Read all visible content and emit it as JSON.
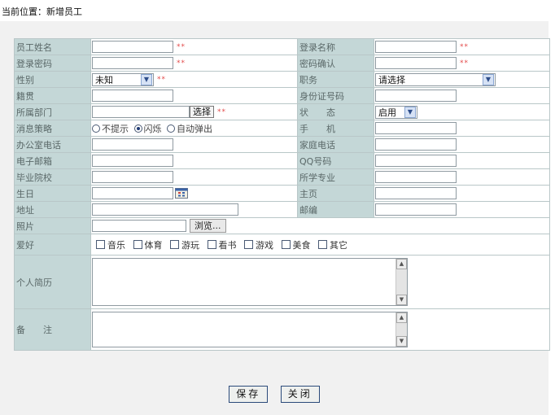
{
  "breadcrumb": "当前位置：新增员工",
  "required_mark": "**",
  "labels": {
    "name": "员工姓名",
    "login_name": "登录名称",
    "password": "登录密码",
    "password_confirm": "密码确认",
    "gender": "性别",
    "position": "职务",
    "native_place": "籍贯",
    "id_number": "身份证号码",
    "department": "所属部门",
    "status": "状　　态",
    "message_policy": "消息策略",
    "mobile": "手　　机",
    "office_phone": "办公室电话",
    "home_phone": "家庭电话",
    "email": "电子邮箱",
    "qq": "QQ号码",
    "school": "毕业院校",
    "major": "所学专业",
    "birthday": "生日",
    "homepage": "主页",
    "address": "地址",
    "postcode": "邮编",
    "photo": "照片",
    "hobbies": "爱好",
    "resume": "个人简历",
    "remark": "备　　注"
  },
  "selects": {
    "gender": "未知",
    "position": "请选择",
    "status": "启用"
  },
  "buttons": {
    "choose": "选择",
    "browse": "浏览...",
    "save": "保存",
    "close": "关闭"
  },
  "message_options": [
    {
      "label": "不提示",
      "checked": false
    },
    {
      "label": "闪烁",
      "checked": true
    },
    {
      "label": "自动弹出",
      "checked": false
    }
  ],
  "hobbies": [
    "音乐",
    "体育",
    "游玩",
    "看书",
    "游戏",
    "美食",
    "其它"
  ],
  "icons": {
    "select_arrow": "chevron-down-icon",
    "calendar": "calendar-icon",
    "scroll_up": "scroll-up-icon",
    "scroll_down": "scroll-down-icon"
  },
  "colors": {
    "label_bg": "#c4d7d7",
    "panel_bg": "#f1f1f1",
    "required": "#e34a4a",
    "border": "#b9c7c8"
  }
}
